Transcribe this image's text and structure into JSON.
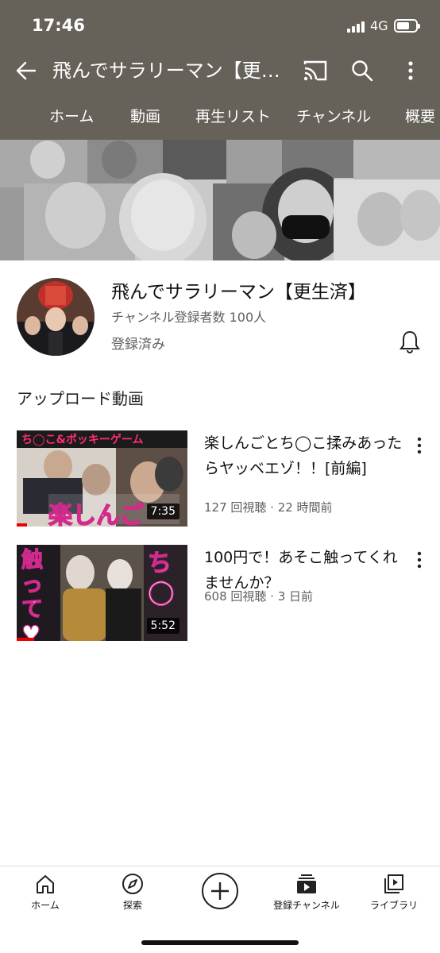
{
  "status_bar": {
    "time": "17:46",
    "network": "4G"
  },
  "app_bar": {
    "title": "飛んでサラリーマン【更…"
  },
  "tabs": [
    "ホーム",
    "動画",
    "再生リスト",
    "チャンネル",
    "概要"
  ],
  "channel": {
    "name": "飛んでサラリーマン【更生済】",
    "subscribers": "チャンネル登録者数 100人",
    "subscribed_label": "登録済み"
  },
  "uploads": {
    "title": "アップロード動画",
    "videos": [
      {
        "title": "楽しんごとち◯こ揉みあったらヤッベエゾ！！[前編]",
        "meta": "127 回視聴 · 22 時間前",
        "duration": "7:35",
        "progress": 0.06,
        "thumb_text_top": "ち◯こ&ポッキーゲーム",
        "thumb_text_bottom": "楽しんご"
      },
      {
        "title": "100円で！あそこ触ってくれませんか？",
        "meta": "608 回視聴 · 3 日前",
        "duration": "5:52",
        "progress": 0.1,
        "thumb_text_left": "触って♥",
        "thumb_text_right": "ち◯"
      }
    ]
  },
  "bottom_nav": [
    {
      "label": "ホーム",
      "icon": "home-icon"
    },
    {
      "label": "探索",
      "icon": "explore-icon"
    },
    {
      "label": "",
      "icon": "create-icon"
    },
    {
      "label": "登録チャンネル",
      "icon": "subscriptions-icon"
    },
    {
      "label": "ライブラリ",
      "icon": "library-icon"
    }
  ],
  "colors": {
    "header_bg": "#66625a",
    "progress": "#ee0000",
    "text_secondary": "#606060"
  }
}
